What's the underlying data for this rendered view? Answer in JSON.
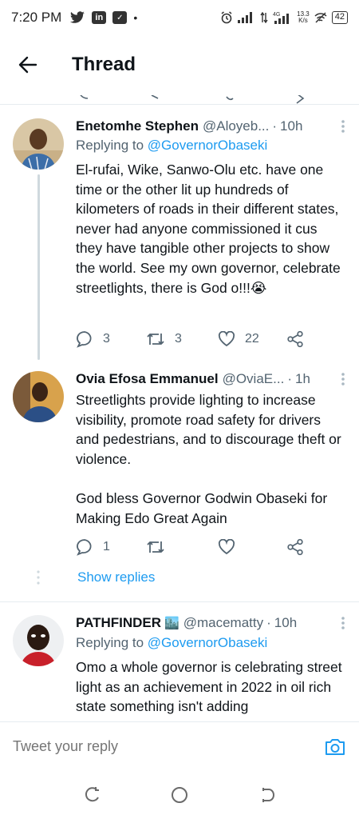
{
  "status_bar": {
    "time": "7:20 PM",
    "net_speed": "13.3\nK/s",
    "battery": "42"
  },
  "header": {
    "title": "Thread"
  },
  "tweets": [
    {
      "name": "Enetomhe Stephen",
      "handle": "@Aloyeb...",
      "time": "10h",
      "replying_label": "Replying to ",
      "replying_to": "@GovernorObaseki",
      "text": "El-rufai, Wike, Sanwo-Olu etc. have one time or the other lit up hundreds of kilometers of roads in their different states, never had anyone commissioned it cus they have tangible other projects to show the world. See my own governor, celebrate streetlights, there is God o!!!😭",
      "replies": "3",
      "retweets": "3",
      "likes": "22"
    },
    {
      "name": "Ovia Efosa Emmanuel",
      "handle": "@OviaE...",
      "time": "1h",
      "text": "Streetlights provide lighting to increase visibility, promote road safety for drivers and pedestrians, and to discourage theft or violence.\n\nGod bless Governor Godwin Obaseki for Making Edo Great Again",
      "replies": "1",
      "retweets": "",
      "likes": "",
      "show_replies": "Show replies"
    },
    {
      "name": "PATHFINDER",
      "name_emoji": "🏙️",
      "handle": "@macematty",
      "time": "10h",
      "replying_label": "Replying to ",
      "replying_to": "@GovernorObaseki",
      "text": "Omo a whole governor is celebrating street light as an achievement in 2022 in oil rich state something isn't adding"
    }
  ],
  "reply_bar": {
    "placeholder": "Tweet your reply"
  },
  "colors": {
    "accent": "#1d9bf0",
    "secondary_text": "#536471",
    "divider": "#e6ecf0"
  }
}
